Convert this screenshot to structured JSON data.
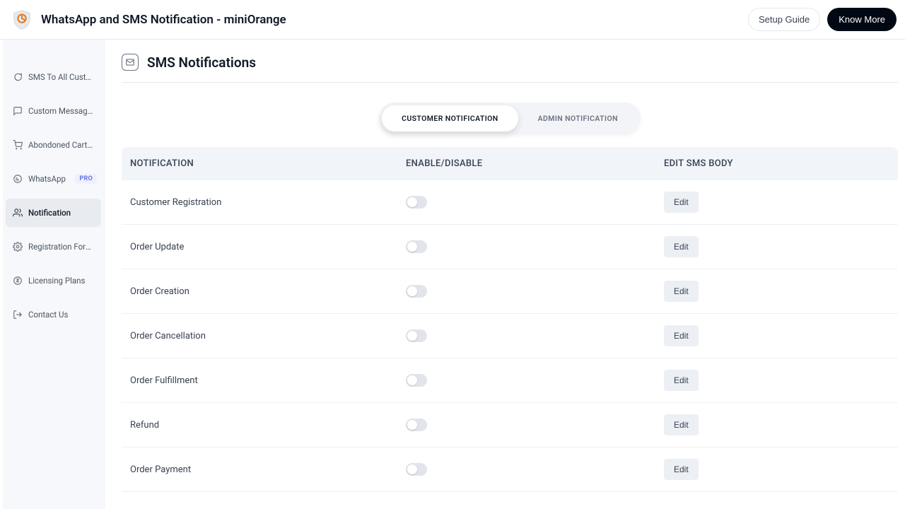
{
  "header": {
    "app_title": "WhatsApp and SMS Notification - miniOrange",
    "setup_guide": "Setup Guide",
    "know_more": "Know More"
  },
  "sidebar": {
    "items": [
      {
        "label": "SMS To All Customers"
      },
      {
        "label": "Custom Messages"
      },
      {
        "label": "Abondoned Cart Noti..."
      },
      {
        "label": "WhatsApp",
        "badge": "PRO"
      },
      {
        "label": "Notification",
        "active": true
      },
      {
        "label": "Registration Form Set..."
      },
      {
        "label": "Licensing Plans"
      },
      {
        "label": "Contact Us"
      }
    ]
  },
  "page": {
    "title": "SMS Notifications",
    "tabs": {
      "customer": "CUSTOMER NOTIFICATION",
      "admin": "ADMIN NOTIFICATION"
    },
    "columns": {
      "c1": "NOTIFICATION",
      "c2": "ENABLE/DISABLE",
      "c3": "EDIT SMS BODY"
    },
    "edit_label": "Edit",
    "rows": [
      {
        "name": "Customer Registration"
      },
      {
        "name": "Order Update"
      },
      {
        "name": "Order Creation"
      },
      {
        "name": "Order Cancellation"
      },
      {
        "name": "Order Fulfillment"
      },
      {
        "name": "Refund"
      },
      {
        "name": "Order Payment"
      }
    ]
  }
}
